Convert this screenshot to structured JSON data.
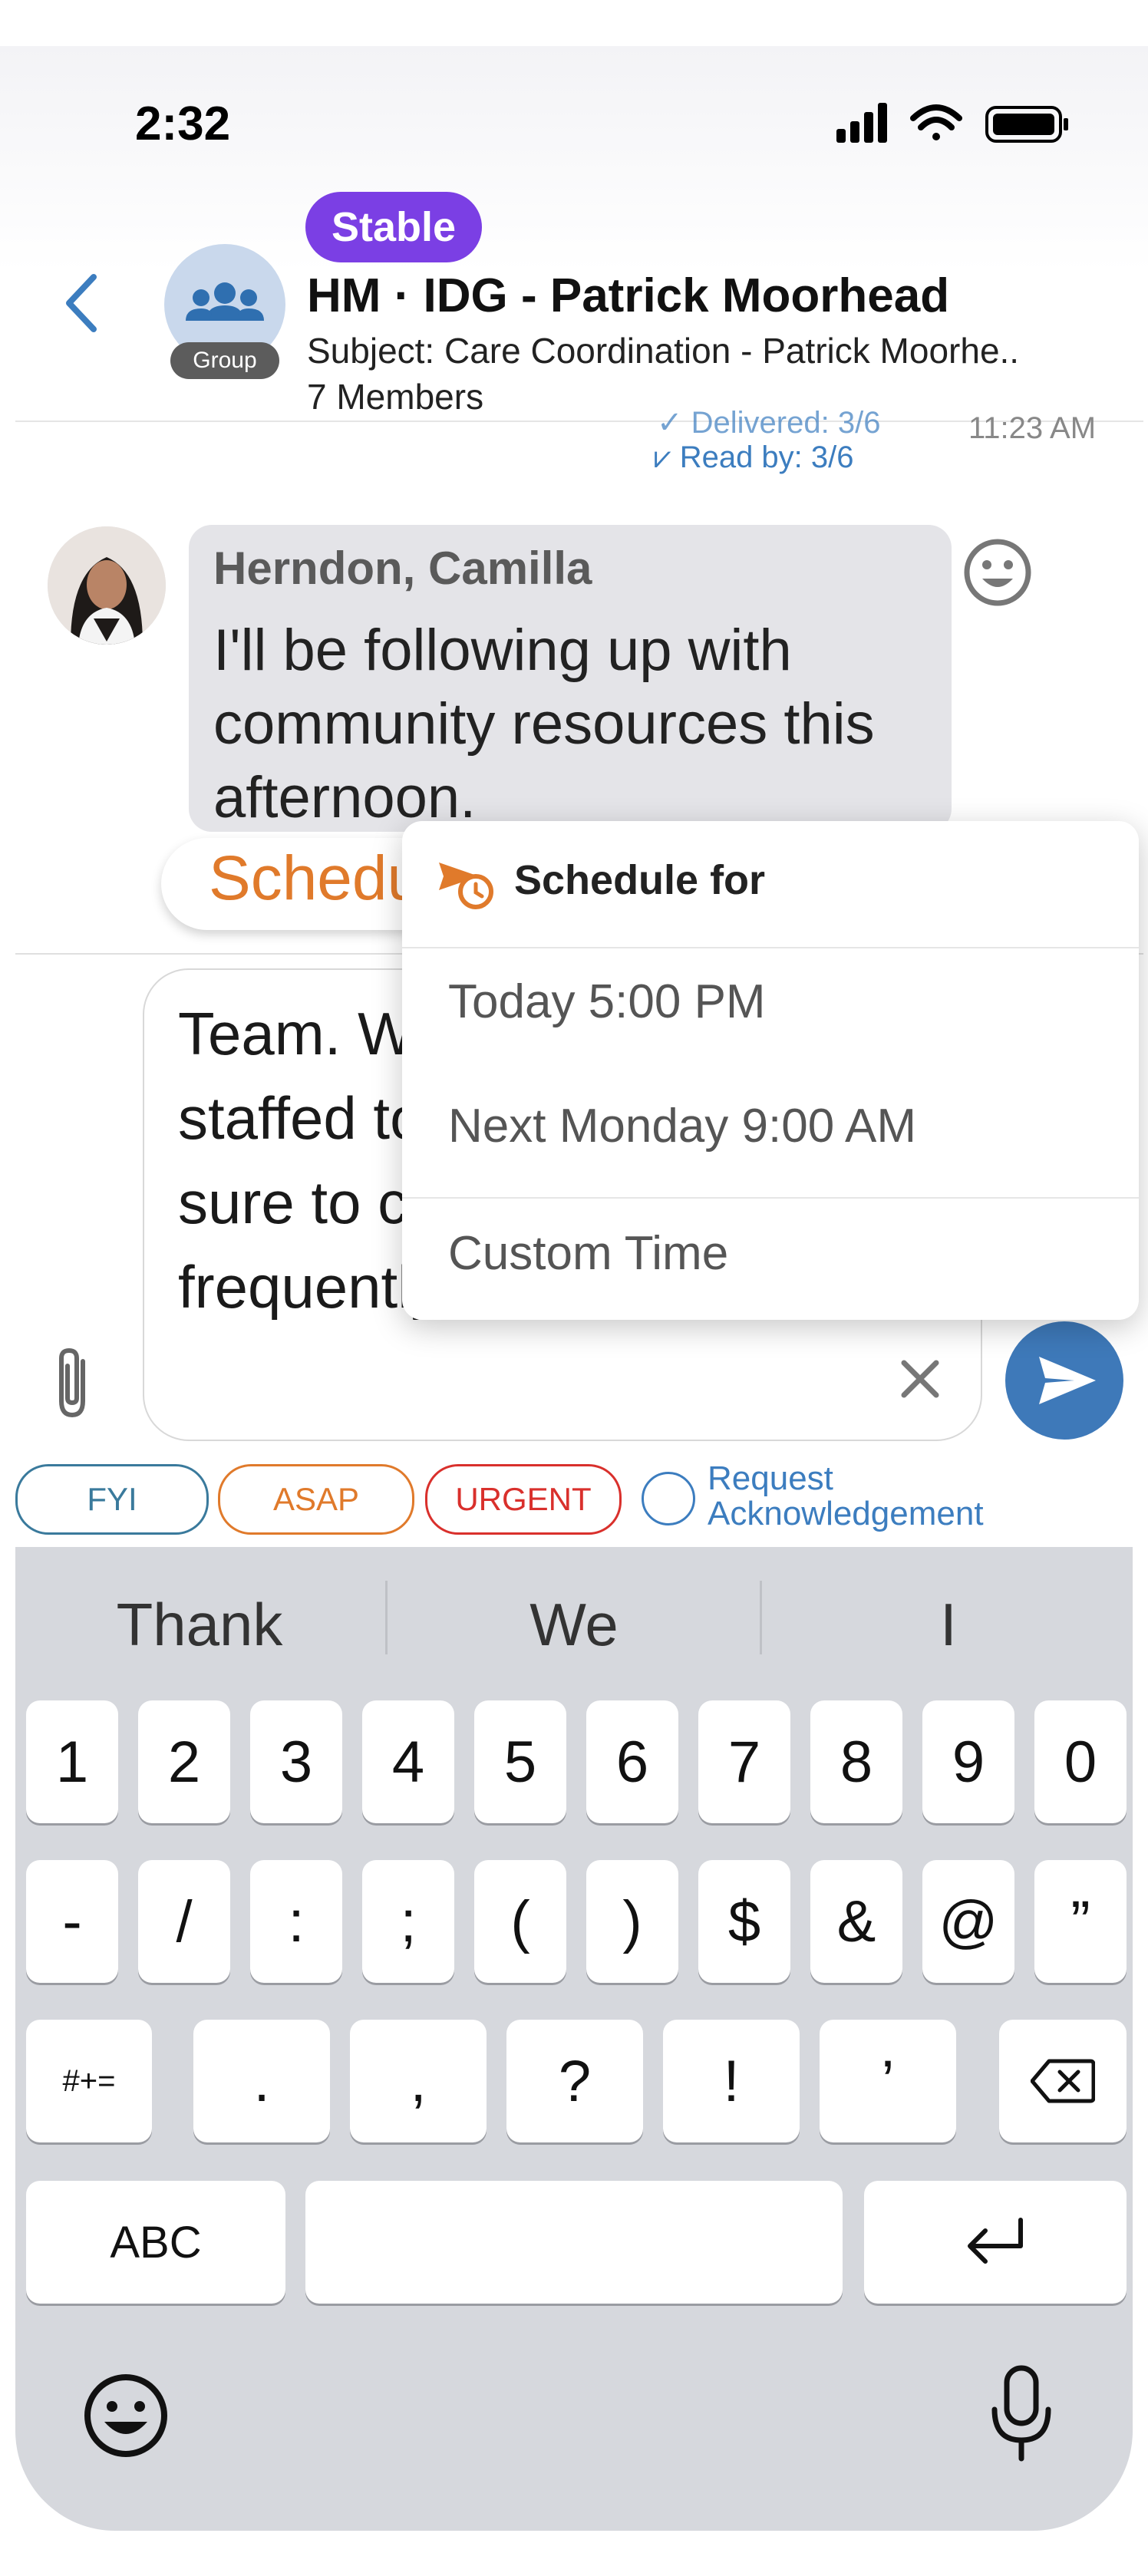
{
  "status_bar": {
    "time": "2:32"
  },
  "header": {
    "badge": "Stable",
    "title": "HM · IDG - Patrick Moorhead",
    "subject": "Subject: Care Coordination - Patrick Moorhe..",
    "members": "7 Members",
    "group_label": "Group"
  },
  "receipts": {
    "delivered": "Delivered: 3/6",
    "read": "Read by: 3/6",
    "time": "11:23 AM"
  },
  "message": {
    "sender": "Herndon, Camilla",
    "text": "I'll be following up with community resources this afternoon."
  },
  "schedule_chip": {
    "label": "Schedule"
  },
  "compose": {
    "text": "Team. We are a bit short staffed today. Please be sure to check messages frequently."
  },
  "priority": {
    "fyi": "FYI",
    "asap": "ASAP",
    "urgent": "URGENT",
    "ack_line1": "Request",
    "ack_line2": "Acknowledgement"
  },
  "dropdown": {
    "title": "Schedule for",
    "items": [
      "Today 5:00 PM",
      "Next Monday 9:00 AM",
      "Custom Time"
    ]
  },
  "keyboard": {
    "suggestions": [
      "Thank",
      "We",
      "I"
    ],
    "row1": [
      "1",
      "2",
      "3",
      "4",
      "5",
      "6",
      "7",
      "8",
      "9",
      "0"
    ],
    "row2": [
      "-",
      "/",
      ":",
      ";",
      "(",
      ")",
      "$",
      "&",
      "@",
      "”"
    ],
    "row3": [
      "#+=",
      ".",
      ",",
      "?",
      "!",
      "’"
    ],
    "abc": "ABC"
  },
  "colors": {
    "accent": "#3e79b9",
    "badge": "#7b3fe4",
    "schedule": "#e07a2b",
    "urgent": "#d9302c"
  }
}
